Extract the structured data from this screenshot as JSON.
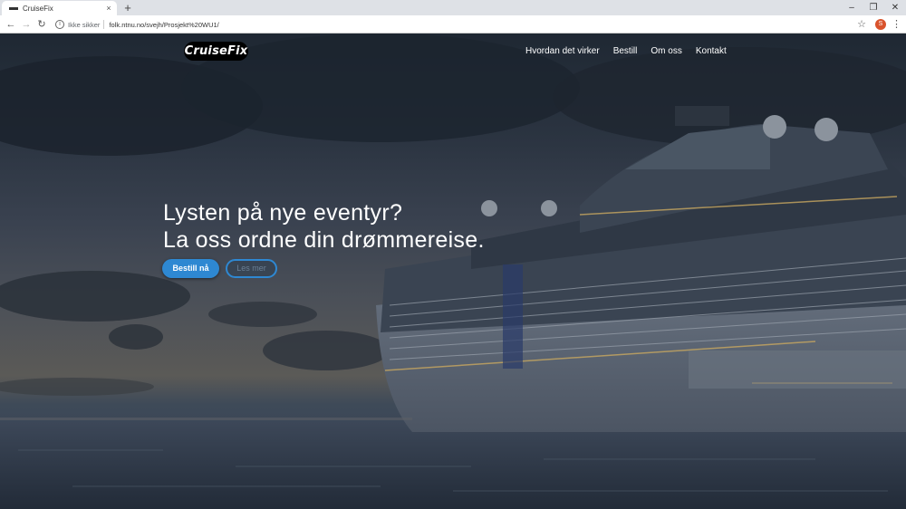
{
  "browser": {
    "tab_title": "CruiseFix",
    "tab_close": "×",
    "new_tab": "+",
    "security_label": "Ikke sikker",
    "url": "folk.ntnu.no/svejh/Prosjekt%20WU1/",
    "profile_initial": "S",
    "icons": [
      "back-arrow-icon",
      "forward-arrow-icon",
      "reload-icon",
      "info-icon",
      "star-icon",
      "menu-dots-icon"
    ]
  },
  "site": {
    "logo": "CruiseFix",
    "nav": [
      "Hvordan det virker",
      "Bestill",
      "Om oss",
      "Kontakt"
    ],
    "hero_line1": "Lysten på nye eventyr?",
    "hero_line2": "La oss ordne din drømmereise.",
    "primary_button": "Bestill nå",
    "secondary_button": "Les mer",
    "accent_color": "#2e88d2"
  }
}
